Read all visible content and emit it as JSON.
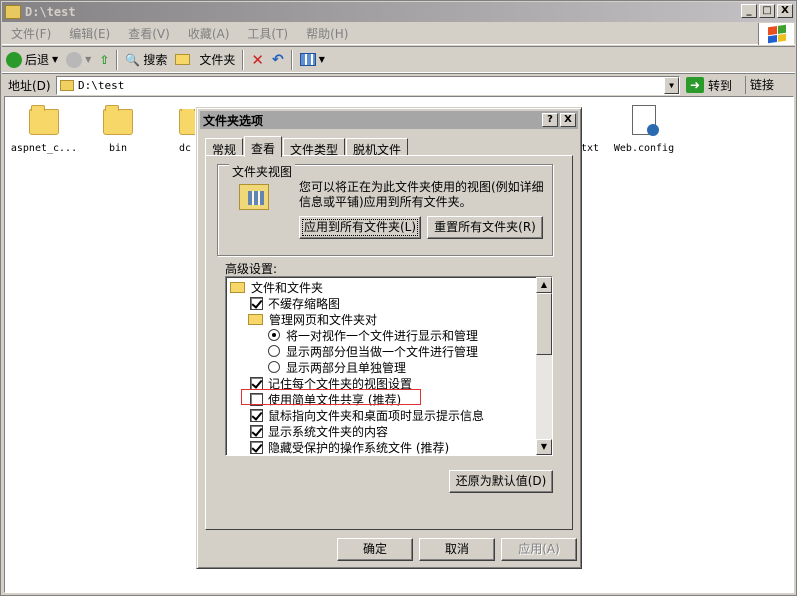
{
  "window": {
    "title": "D:\\test",
    "btn_min": "_",
    "btn_max": "□",
    "btn_close": "X"
  },
  "menubar": [
    "文件(F)",
    "编辑(E)",
    "查看(V)",
    "收藏(A)",
    "工具(T)",
    "帮助(H)"
  ],
  "toolbar": {
    "back": "后退",
    "search": "搜索",
    "folders": "文件夹"
  },
  "address": {
    "label": "地址(D)",
    "value": "D:\\test",
    "goto": "转到",
    "links": "链接"
  },
  "files": [
    {
      "name": "aspnet_c...",
      "type": "folder"
    },
    {
      "name": "bin",
      "type": "folder"
    },
    {
      "name": "dc",
      "type": "folder"
    },
    {
      "name": "txt",
      "type": "file"
    },
    {
      "name": "Web.config",
      "type": "config"
    }
  ],
  "dialog": {
    "title": "文件夹选项",
    "help": "?",
    "close": "X",
    "tabs": [
      "常规",
      "查看",
      "文件类型",
      "脱机文件"
    ],
    "active_tab": "查看",
    "group_title": "文件夹视图",
    "group_desc": "您可以将正在为此文件夹使用的视图(例如详细信息或平铺)应用到所有文件夹。",
    "apply_all": "应用到所有文件夹(L)",
    "reset_all": "重置所有文件夹(R)",
    "advanced_label": "高级设置:",
    "tree": [
      {
        "kind": "folder",
        "indent": 0,
        "label": "文件和文件夹"
      },
      {
        "kind": "check",
        "indent": 1,
        "checked": true,
        "label": "不缓存缩略图"
      },
      {
        "kind": "folder",
        "indent": 1,
        "label": "管理网页和文件夹对"
      },
      {
        "kind": "radio",
        "indent": 2,
        "checked": true,
        "label": "将一对视作一个文件进行显示和管理"
      },
      {
        "kind": "radio",
        "indent": 2,
        "checked": false,
        "label": "显示两部分但当做一个文件进行管理"
      },
      {
        "kind": "radio",
        "indent": 2,
        "checked": false,
        "label": "显示两部分且单独管理"
      },
      {
        "kind": "check",
        "indent": 1,
        "checked": true,
        "label": "记住每个文件夹的视图设置"
      },
      {
        "kind": "check",
        "indent": 1,
        "checked": false,
        "label": "使用简单文件共享 (推荐)"
      },
      {
        "kind": "check",
        "indent": 1,
        "checked": true,
        "label": "鼠标指向文件夹和桌面项时显示提示信息"
      },
      {
        "kind": "check",
        "indent": 1,
        "checked": true,
        "label": "显示系统文件夹的内容"
      },
      {
        "kind": "check",
        "indent": 1,
        "checked": true,
        "label": "隐藏受保护的操作系统文件 (推荐)"
      }
    ],
    "restore_defaults": "还原为默认值(D)",
    "ok": "确定",
    "cancel": "取消",
    "apply": "应用(A)"
  },
  "colors": {
    "highlight_box": "#e03030"
  }
}
